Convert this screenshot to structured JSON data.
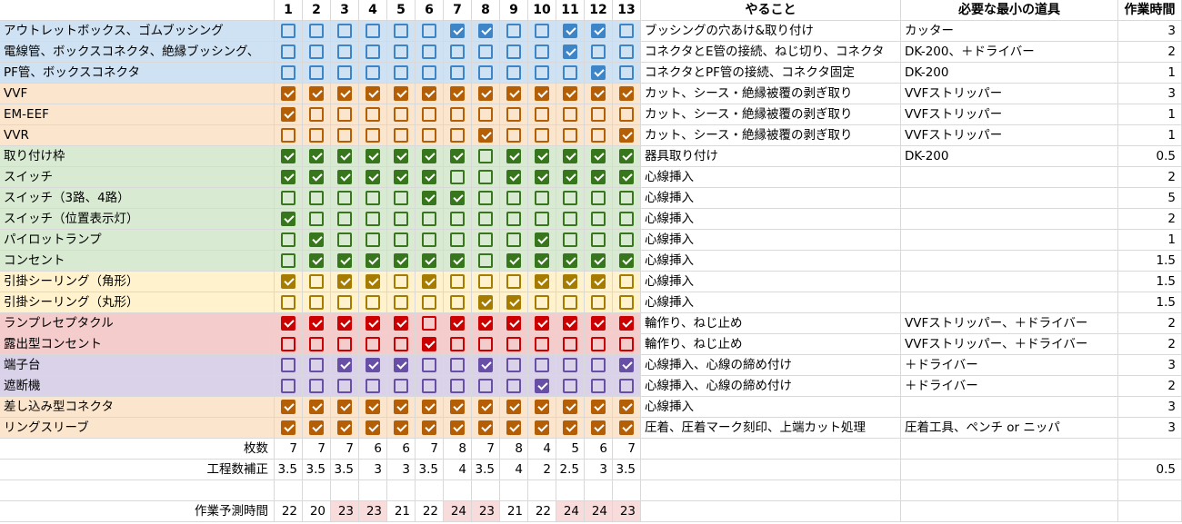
{
  "headers": {
    "cols": [
      "1",
      "2",
      "3",
      "4",
      "5",
      "6",
      "7",
      "8",
      "9",
      "10",
      "11",
      "12",
      "13"
    ],
    "task": "やること",
    "tool": "必要な最小の道具",
    "time": "作業時間"
  },
  "colors": {
    "blue": "#cfe2f3",
    "orange": "#fce5cd",
    "green": "#d9ead3",
    "yellow": "#fff2cc",
    "red": "#f4cccc",
    "purple": "#d9d2e9",
    "cb_blue": "#3d85c6",
    "cb_orange": "#b45f06",
    "cb_green": "#38761d",
    "cb_yellow": "#a67c00",
    "cb_red": "#cc0000",
    "cb_purple": "#674ea7",
    "pink": "#f8dcdc"
  },
  "rows": [
    {
      "label": "アウトレットボックス、ゴムブッシング",
      "group": "blue",
      "checks": [
        0,
        0,
        0,
        0,
        0,
        0,
        1,
        1,
        0,
        0,
        1,
        1,
        0
      ],
      "task": "ブッシングの穴あけ&取り付け",
      "tool": "カッター",
      "time": "3"
    },
    {
      "label": "電線管、ボックスコネクタ、絶縁ブッシング、",
      "group": "blue",
      "checks": [
        0,
        0,
        0,
        0,
        0,
        0,
        0,
        0,
        0,
        0,
        1,
        0,
        0
      ],
      "task": "コネクタとE管の接続、ねじ切り、コネクタ",
      "tool": "DK-200、＋ドライバー",
      "time": "2"
    },
    {
      "label": "PF管、ボックスコネクタ",
      "group": "blue",
      "checks": [
        0,
        0,
        0,
        0,
        0,
        0,
        0,
        0,
        0,
        0,
        0,
        1,
        0
      ],
      "task": "コネクタとPF管の接続、コネクタ固定",
      "tool": "DK-200",
      "time": "1"
    },
    {
      "label": "VVF",
      "group": "orange",
      "checks": [
        1,
        1,
        1,
        1,
        1,
        1,
        1,
        1,
        1,
        1,
        1,
        1,
        1
      ],
      "task": "カット、シース・絶縁被覆の剥ぎ取り",
      "tool": "VVFストリッパー",
      "time": "3"
    },
    {
      "label": "EM-EEF",
      "group": "orange",
      "checks": [
        1,
        0,
        0,
        0,
        0,
        0,
        0,
        0,
        0,
        0,
        0,
        0,
        0
      ],
      "task": "カット、シース・絶縁被覆の剥ぎ取り",
      "tool": "VVFストリッパー",
      "time": "1"
    },
    {
      "label": "VVR",
      "group": "orange",
      "checks": [
        0,
        0,
        0,
        0,
        0,
        0,
        0,
        1,
        0,
        0,
        0,
        0,
        1
      ],
      "task": "カット、シース・絶縁被覆の剥ぎ取り",
      "tool": "VVFストリッパー",
      "time": "1"
    },
    {
      "label": "取り付け枠",
      "group": "green",
      "checks": [
        1,
        1,
        1,
        1,
        1,
        1,
        1,
        0,
        1,
        1,
        1,
        1,
        1
      ],
      "task": "器具取り付け",
      "tool": "DK-200",
      "time": "0.5"
    },
    {
      "label": "スイッチ",
      "group": "green",
      "checks": [
        1,
        1,
        1,
        1,
        1,
        1,
        0,
        0,
        1,
        1,
        1,
        1,
        1
      ],
      "task": "心線挿入",
      "tool": "",
      "time": "2"
    },
    {
      "label": "スイッチ（3路、4路）",
      "group": "green",
      "checks": [
        0,
        0,
        0,
        0,
        0,
        1,
        1,
        0,
        0,
        0,
        0,
        0,
        0
      ],
      "task": "心線挿入",
      "tool": "",
      "time": "5"
    },
    {
      "label": "スイッチ（位置表示灯）",
      "group": "green",
      "checks": [
        1,
        0,
        0,
        0,
        0,
        0,
        0,
        0,
        0,
        0,
        0,
        0,
        0
      ],
      "task": "心線挿入",
      "tool": "",
      "time": "2"
    },
    {
      "label": "パイロットランプ",
      "group": "green",
      "checks": [
        0,
        1,
        0,
        0,
        0,
        0,
        0,
        0,
        0,
        1,
        0,
        0,
        0
      ],
      "task": "心線挿入",
      "tool": "",
      "time": "1"
    },
    {
      "label": "コンセント",
      "group": "green",
      "checks": [
        0,
        1,
        1,
        1,
        1,
        1,
        1,
        0,
        1,
        1,
        1,
        1,
        1
      ],
      "task": "心線挿入",
      "tool": "",
      "time": "1.5"
    },
    {
      "label": "引掛シーリング（角形）",
      "group": "yellow",
      "checks": [
        1,
        0,
        1,
        1,
        0,
        1,
        0,
        0,
        0,
        1,
        1,
        1,
        0
      ],
      "task": "心線挿入",
      "tool": "",
      "time": "1.5"
    },
    {
      "label": "引掛シーリング（丸形）",
      "group": "yellow",
      "checks": [
        0,
        0,
        0,
        0,
        0,
        0,
        0,
        1,
        1,
        0,
        0,
        0,
        0
      ],
      "task": "心線挿入",
      "tool": "",
      "time": "1.5"
    },
    {
      "label": "ランプレセプタクル",
      "group": "red",
      "checks": [
        1,
        1,
        1,
        1,
        1,
        0,
        1,
        1,
        1,
        1,
        1,
        1,
        1
      ],
      "task": "輪作り、ねじ止め",
      "tool": "VVFストリッパー、＋ドライバー",
      "time": "2"
    },
    {
      "label": "露出型コンセント",
      "group": "red",
      "checks": [
        0,
        0,
        0,
        0,
        0,
        1,
        0,
        0,
        0,
        0,
        0,
        0,
        0
      ],
      "task": "輪作り、ねじ止め",
      "tool": "VVFストリッパー、＋ドライバー",
      "time": "2"
    },
    {
      "label": "端子台",
      "group": "purple",
      "checks": [
        0,
        0,
        1,
        1,
        1,
        0,
        0,
        1,
        0,
        0,
        0,
        0,
        1
      ],
      "task": "心線挿入、心線の締め付け",
      "tool": "＋ドライバー",
      "time": "3"
    },
    {
      "label": "遮断機",
      "group": "purple",
      "checks": [
        0,
        0,
        0,
        0,
        0,
        0,
        0,
        0,
        0,
        1,
        0,
        0,
        0
      ],
      "task": "心線挿入、心線の締め付け",
      "tool": "＋ドライバー",
      "time": "2"
    },
    {
      "label": "差し込み型コネクタ",
      "group": "orange",
      "checks": [
        1,
        1,
        1,
        1,
        1,
        1,
        1,
        1,
        1,
        1,
        1,
        1,
        1
      ],
      "task": "心線挿入",
      "tool": "",
      "time": "3"
    },
    {
      "label": "リングスリーブ",
      "group": "orange",
      "checks": [
        1,
        1,
        1,
        1,
        1,
        1,
        1,
        1,
        1,
        1,
        1,
        1,
        1
      ],
      "task": "圧着、圧着マーク刻印、上端カット処理",
      "tool": "圧着工具、ペンチ or ニッパ",
      "time": "3"
    }
  ],
  "summary": {
    "count_label": "枚数",
    "counts": [
      "7",
      "7",
      "7",
      "6",
      "6",
      "7",
      "8",
      "7",
      "8",
      "4",
      "5",
      "6",
      "7"
    ],
    "proc_label": "工程数補正",
    "procs": [
      "3.5",
      "3.5",
      "3.5",
      "3",
      "3",
      "3.5",
      "4",
      "3.5",
      "4",
      "2",
      "2.5",
      "3",
      "3.5"
    ],
    "proc_time": "0.5",
    "est_label": "作業予測時間",
    "ests": [
      "22",
      "20",
      "23",
      "23",
      "21",
      "22",
      "24",
      "23",
      "21",
      "22",
      "24",
      "24",
      "23"
    ],
    "est_highlight": [
      0,
      0,
      1,
      1,
      0,
      0,
      1,
      1,
      0,
      0,
      1,
      1,
      1
    ]
  }
}
